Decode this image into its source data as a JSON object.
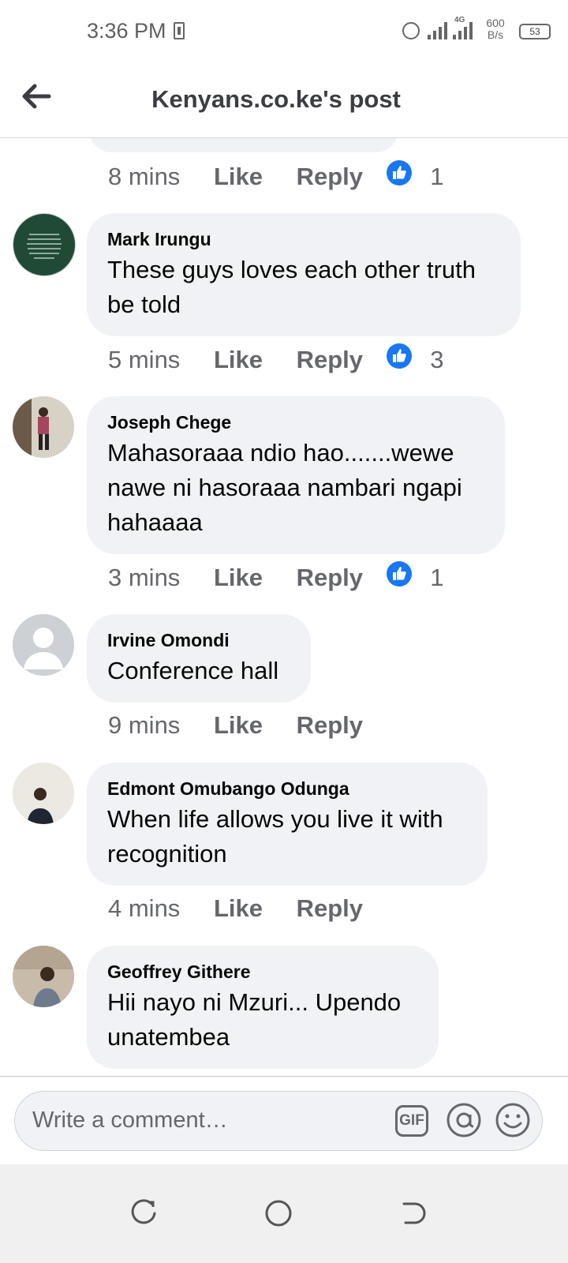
{
  "status_bar": {
    "time": "3:36 PM",
    "network": "4G",
    "speed_value": "600",
    "speed_unit": "B/s",
    "battery": "53"
  },
  "header": {
    "title": "Kenyans.co.ke's post"
  },
  "comments": [
    {
      "time": "8 mins",
      "like": "Like",
      "reply": "Reply",
      "reactions": "1"
    },
    {
      "name": "Mark Irungu",
      "text": "These guys loves each other truth be told",
      "time": "5 mins",
      "like": "Like",
      "reply": "Reply",
      "reactions": "3"
    },
    {
      "name": "Joseph Chege",
      "text": "Mahasoraaa ndio hao.......wewe nawe ni hasoraaa nambari ngapi hahaaaa",
      "time": "3 mins",
      "like": "Like",
      "reply": "Reply",
      "reactions": "1"
    },
    {
      "name": "Irvine Omondi",
      "text": "Conference hall",
      "time": "9 mins",
      "like": "Like",
      "reply": "Reply"
    },
    {
      "name": "Edmont Omubango Odunga",
      "text": "When life allows you live it with recognition",
      "time": "4 mins",
      "like": "Like",
      "reply": "Reply"
    },
    {
      "name": "Geoffrey Githere",
      "text": "Hii nayo ni Mzuri... Upendo unatembea"
    }
  ],
  "composer": {
    "placeholder": "Write a comment…",
    "gif_label": "GIF"
  },
  "colors": {
    "bubble": "#f0f2f5",
    "like_blue": "#1877f2",
    "meta_gray": "#65676b"
  }
}
